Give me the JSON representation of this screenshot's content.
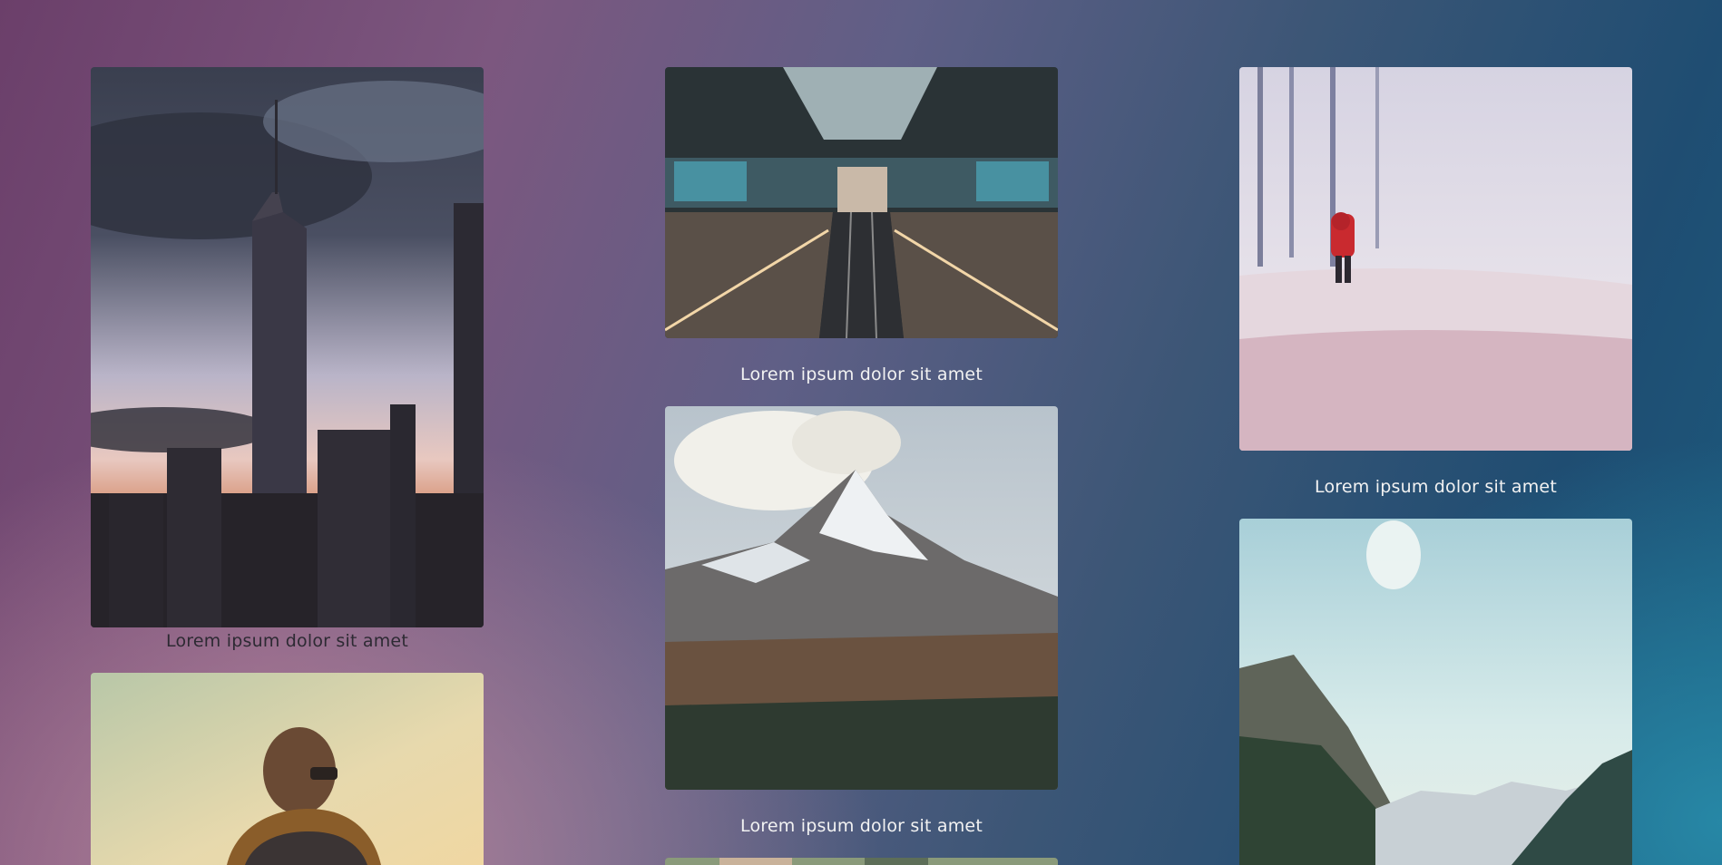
{
  "gallery": {
    "columns": [
      {
        "items": [
          {
            "caption": "Lorem ipsum dolor sit amet",
            "image": "city-skyline-tower"
          },
          {
            "caption": "",
            "image": "person-sunglasses-scarf"
          }
        ]
      },
      {
        "items": [
          {
            "caption": "Lorem ipsum dolor sit amet",
            "image": "escalator-station"
          },
          {
            "caption": "Lorem ipsum dolor sit amet",
            "image": "snowy-mountain-peak"
          },
          {
            "caption": "",
            "image": "partial-image"
          }
        ]
      },
      {
        "items": [
          {
            "caption": "Lorem ipsum dolor sit amet",
            "image": "person-red-coat-snow"
          },
          {
            "caption": "",
            "image": "mountain-valley"
          }
        ]
      }
    ]
  }
}
